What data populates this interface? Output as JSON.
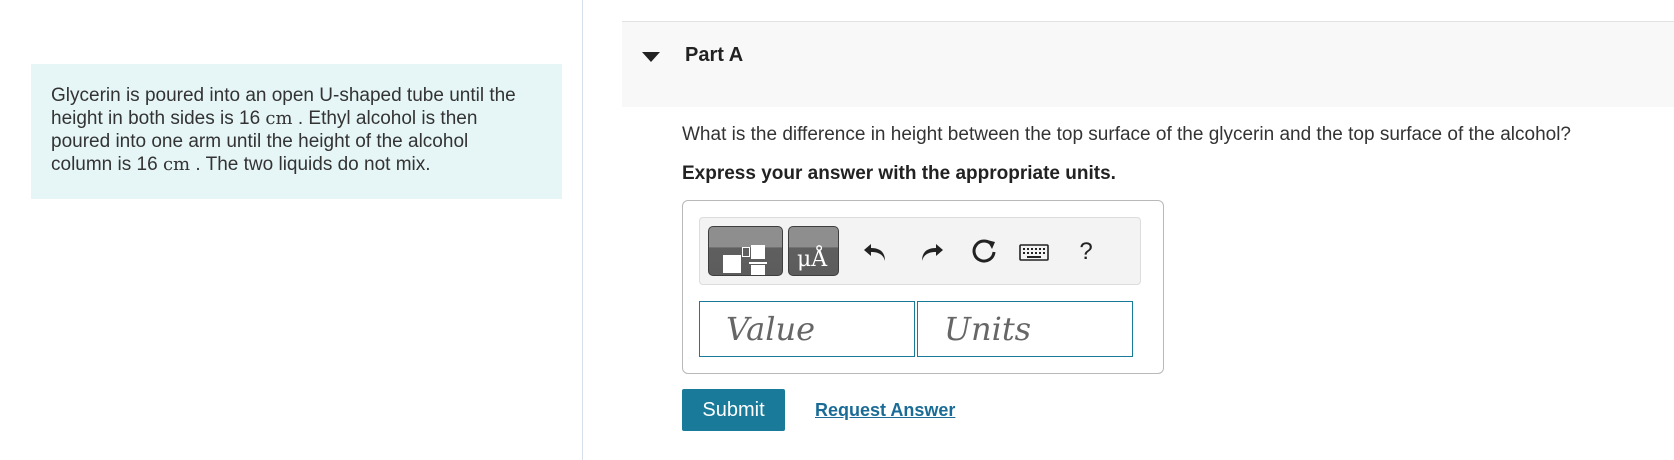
{
  "problem": {
    "line1": "Glycerin is poured into an open U-shaped tube until the",
    "line2_pre": "height in both sides is 16 ",
    "line2_unit": "cm",
    "line2_post": " . Ethyl alcohol is then",
    "line3": "poured into one arm until the height of the alcohol",
    "line4_pre": "column is 16 ",
    "line4_unit": "cm",
    "line4_post": " . The two liquids do not mix."
  },
  "part": {
    "title": "Part A",
    "question": "What is the difference in height between the top surface of the glycerin and the top surface of the alcohol?",
    "instruction": "Express your answer with the appropriate units."
  },
  "toolbar": {
    "templates_icon": "templates-icon",
    "units_glyph": "μÅ",
    "undo_icon": "undo-icon",
    "redo_icon": "redo-icon",
    "reset_icon": "reset-icon",
    "keyboard_icon": "keyboard-icon",
    "help_label": "?"
  },
  "answer": {
    "value_placeholder": "Value",
    "units_placeholder": "Units",
    "value": "",
    "units": ""
  },
  "actions": {
    "submit_label": "Submit",
    "request_label": "Request Answer"
  },
  "colors": {
    "accent": "#1a7a99",
    "problem_bg": "#e6f6f7",
    "link": "#1a6c96"
  }
}
